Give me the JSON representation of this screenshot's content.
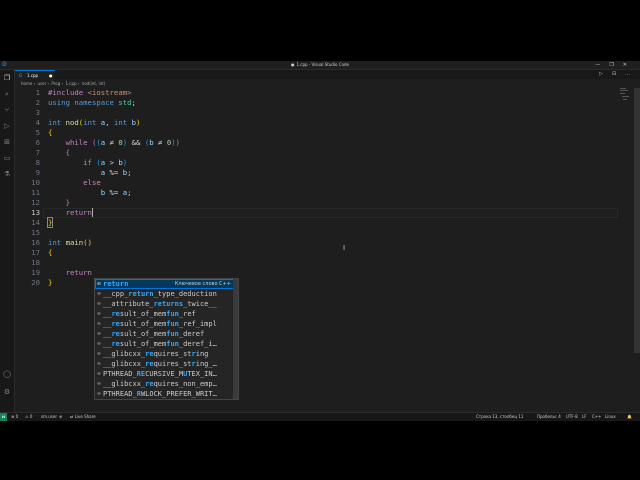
{
  "window": {
    "title": "1.cpp - Visual Studio Code",
    "modified_dot": "●",
    "controls": [
      "—",
      "❐",
      "✕"
    ]
  },
  "activity_bar": {
    "items": [
      "explorer",
      "search",
      "source-control",
      "run-debug",
      "extensions",
      "remote-explorer",
      "testing",
      "live-share"
    ],
    "bottom": [
      "account",
      "settings"
    ]
  },
  "tab": {
    "file_icon": "G",
    "name": "1.cpp",
    "dirty_dot": "●"
  },
  "tab_actions": [
    "▷",
    "⊟",
    "…"
  ],
  "breadcrumb": [
    "home",
    "user",
    "Prog",
    "1.cpp",
    "nod(int, int)"
  ],
  "editor": {
    "current_line": 13,
    "lines": [
      {
        "n": "1"
      },
      {
        "n": "2"
      },
      {
        "n": "3"
      },
      {
        "n": "4"
      },
      {
        "n": "5"
      },
      {
        "n": "6"
      },
      {
        "n": "7"
      },
      {
        "n": "8"
      },
      {
        "n": "9"
      },
      {
        "n": "10"
      },
      {
        "n": "11"
      },
      {
        "n": "12"
      },
      {
        "n": "13"
      },
      {
        "n": "14"
      },
      {
        "n": "15"
      },
      {
        "n": "16"
      },
      {
        "n": "17"
      },
      {
        "n": "18"
      },
      {
        "n": "19"
      },
      {
        "n": "20"
      }
    ],
    "tokens": {
      "l1_pp": "#include",
      "l1_inc": "<iostream>",
      "l2_using": "using",
      "l2_ns": "namespace",
      "l2_std": "std",
      "l2_semi": ";",
      "l4_int": "int",
      "l4_fn": "nod",
      "l4_open": "(",
      "l4_int2": "int",
      "l4_a": "a",
      "l4_comma": ",",
      "l4_int3": "int",
      "l4_b": "b",
      "l4_close": ")",
      "l5_brace": "{",
      "l6_while": "while",
      "l6_open": "(",
      "l6_inner_open": "(",
      "l6_a": "a",
      "l6_ne": "≠",
      "l6_zero": "0",
      "l6_inner_close": ")",
      "l6_and": "&&",
      "l6_inner2_open": "(",
      "l6_b": "b",
      "l6_ne2": "≠",
      "l6_zero2": "0",
      "l6_inner2_close": ")",
      "l6_close": ")",
      "l7_brace": "{",
      "l8_if": "if",
      "l8_open": "(",
      "l8_a": "a",
      "l8_gt": ">",
      "l8_b": "b",
      "l8_close": ")",
      "l9_a": "a",
      "l9_op": "%=",
      "l9_b": "b",
      "l9_semi": ";",
      "l10_else": "else",
      "l11_b": "b",
      "l11_op": "%=",
      "l11_a": "a",
      "l11_semi": ";",
      "l12_brace": "}",
      "l13_return": "return",
      "l14_brace": "}",
      "l16_int": "int",
      "l16_fn": "main",
      "l16_parens": "()",
      "l17_brace": "{",
      "l19_return": "return",
      "l20_brace": "}"
    }
  },
  "suggest": {
    "items": [
      {
        "icon": "⊞",
        "match": "return",
        "rest": "",
        "detail": "Ключевое слово C++"
      },
      {
        "icon": "∞",
        "pre": "__cpp_",
        "match": "return",
        "rest": "_type_deduction"
      },
      {
        "icon": "∞",
        "pre": "__attribute_",
        "match": "returns",
        "rest": "_twice__"
      },
      {
        "icon": "∞",
        "pre": "__",
        "match": "re",
        "mid": "sult_of_mem",
        "match2": "fun",
        "rest": "_ref"
      },
      {
        "icon": "∞",
        "pre": "__",
        "match": "re",
        "mid": "sult_of_mem",
        "match2": "fun",
        "rest": "_ref_impl"
      },
      {
        "icon": "∞",
        "pre": "__",
        "match": "re",
        "mid": "sult_of_mem",
        "match2": "fun",
        "rest": "_deref"
      },
      {
        "icon": "∞",
        "pre": "__",
        "match": "re",
        "mid": "sult_of_mem",
        "match2": "fun",
        "rest": "_deref_i…"
      },
      {
        "icon": "∞",
        "pre": "__glibcxx_",
        "match": "re",
        "mid": "quires_st",
        "match2": "r",
        "rest": "ing"
      },
      {
        "icon": "∞",
        "pre": "__glibcxx_",
        "match": "re",
        "mid": "quires_st",
        "match2": "r",
        "rest": "ing_…"
      },
      {
        "icon": "∞",
        "pre": "PTHREAD_",
        "match": "RE",
        "mid": "CURSIVE_M",
        "match2": "U",
        "rest": "TEX_IN…"
      },
      {
        "icon": "∞",
        "pre": "__glibcxx_",
        "match": "re",
        "mid": "quires_non_emp…",
        "match2": "",
        "rest": ""
      },
      {
        "icon": "∞",
        "pre": "PTHREAD_",
        "match": "R",
        "mid": "WLOCK_PREFER_WRIT…",
        "match2": "",
        "rest": ""
      }
    ]
  },
  "status_bar": {
    "remote_icon": "⋈",
    "errors": "⊗ 0",
    "warnings": "⚠ 0",
    "user": "sm.user",
    "user_icon": "⊕",
    "live_share": "⇄ Live Share",
    "position": "Строка 13, столбец 11",
    "spaces": "Пробелы: 4",
    "encoding": "UTF-8",
    "eol": "LF",
    "language": "C++",
    "platform": "Linux",
    "bell": "🔔"
  }
}
